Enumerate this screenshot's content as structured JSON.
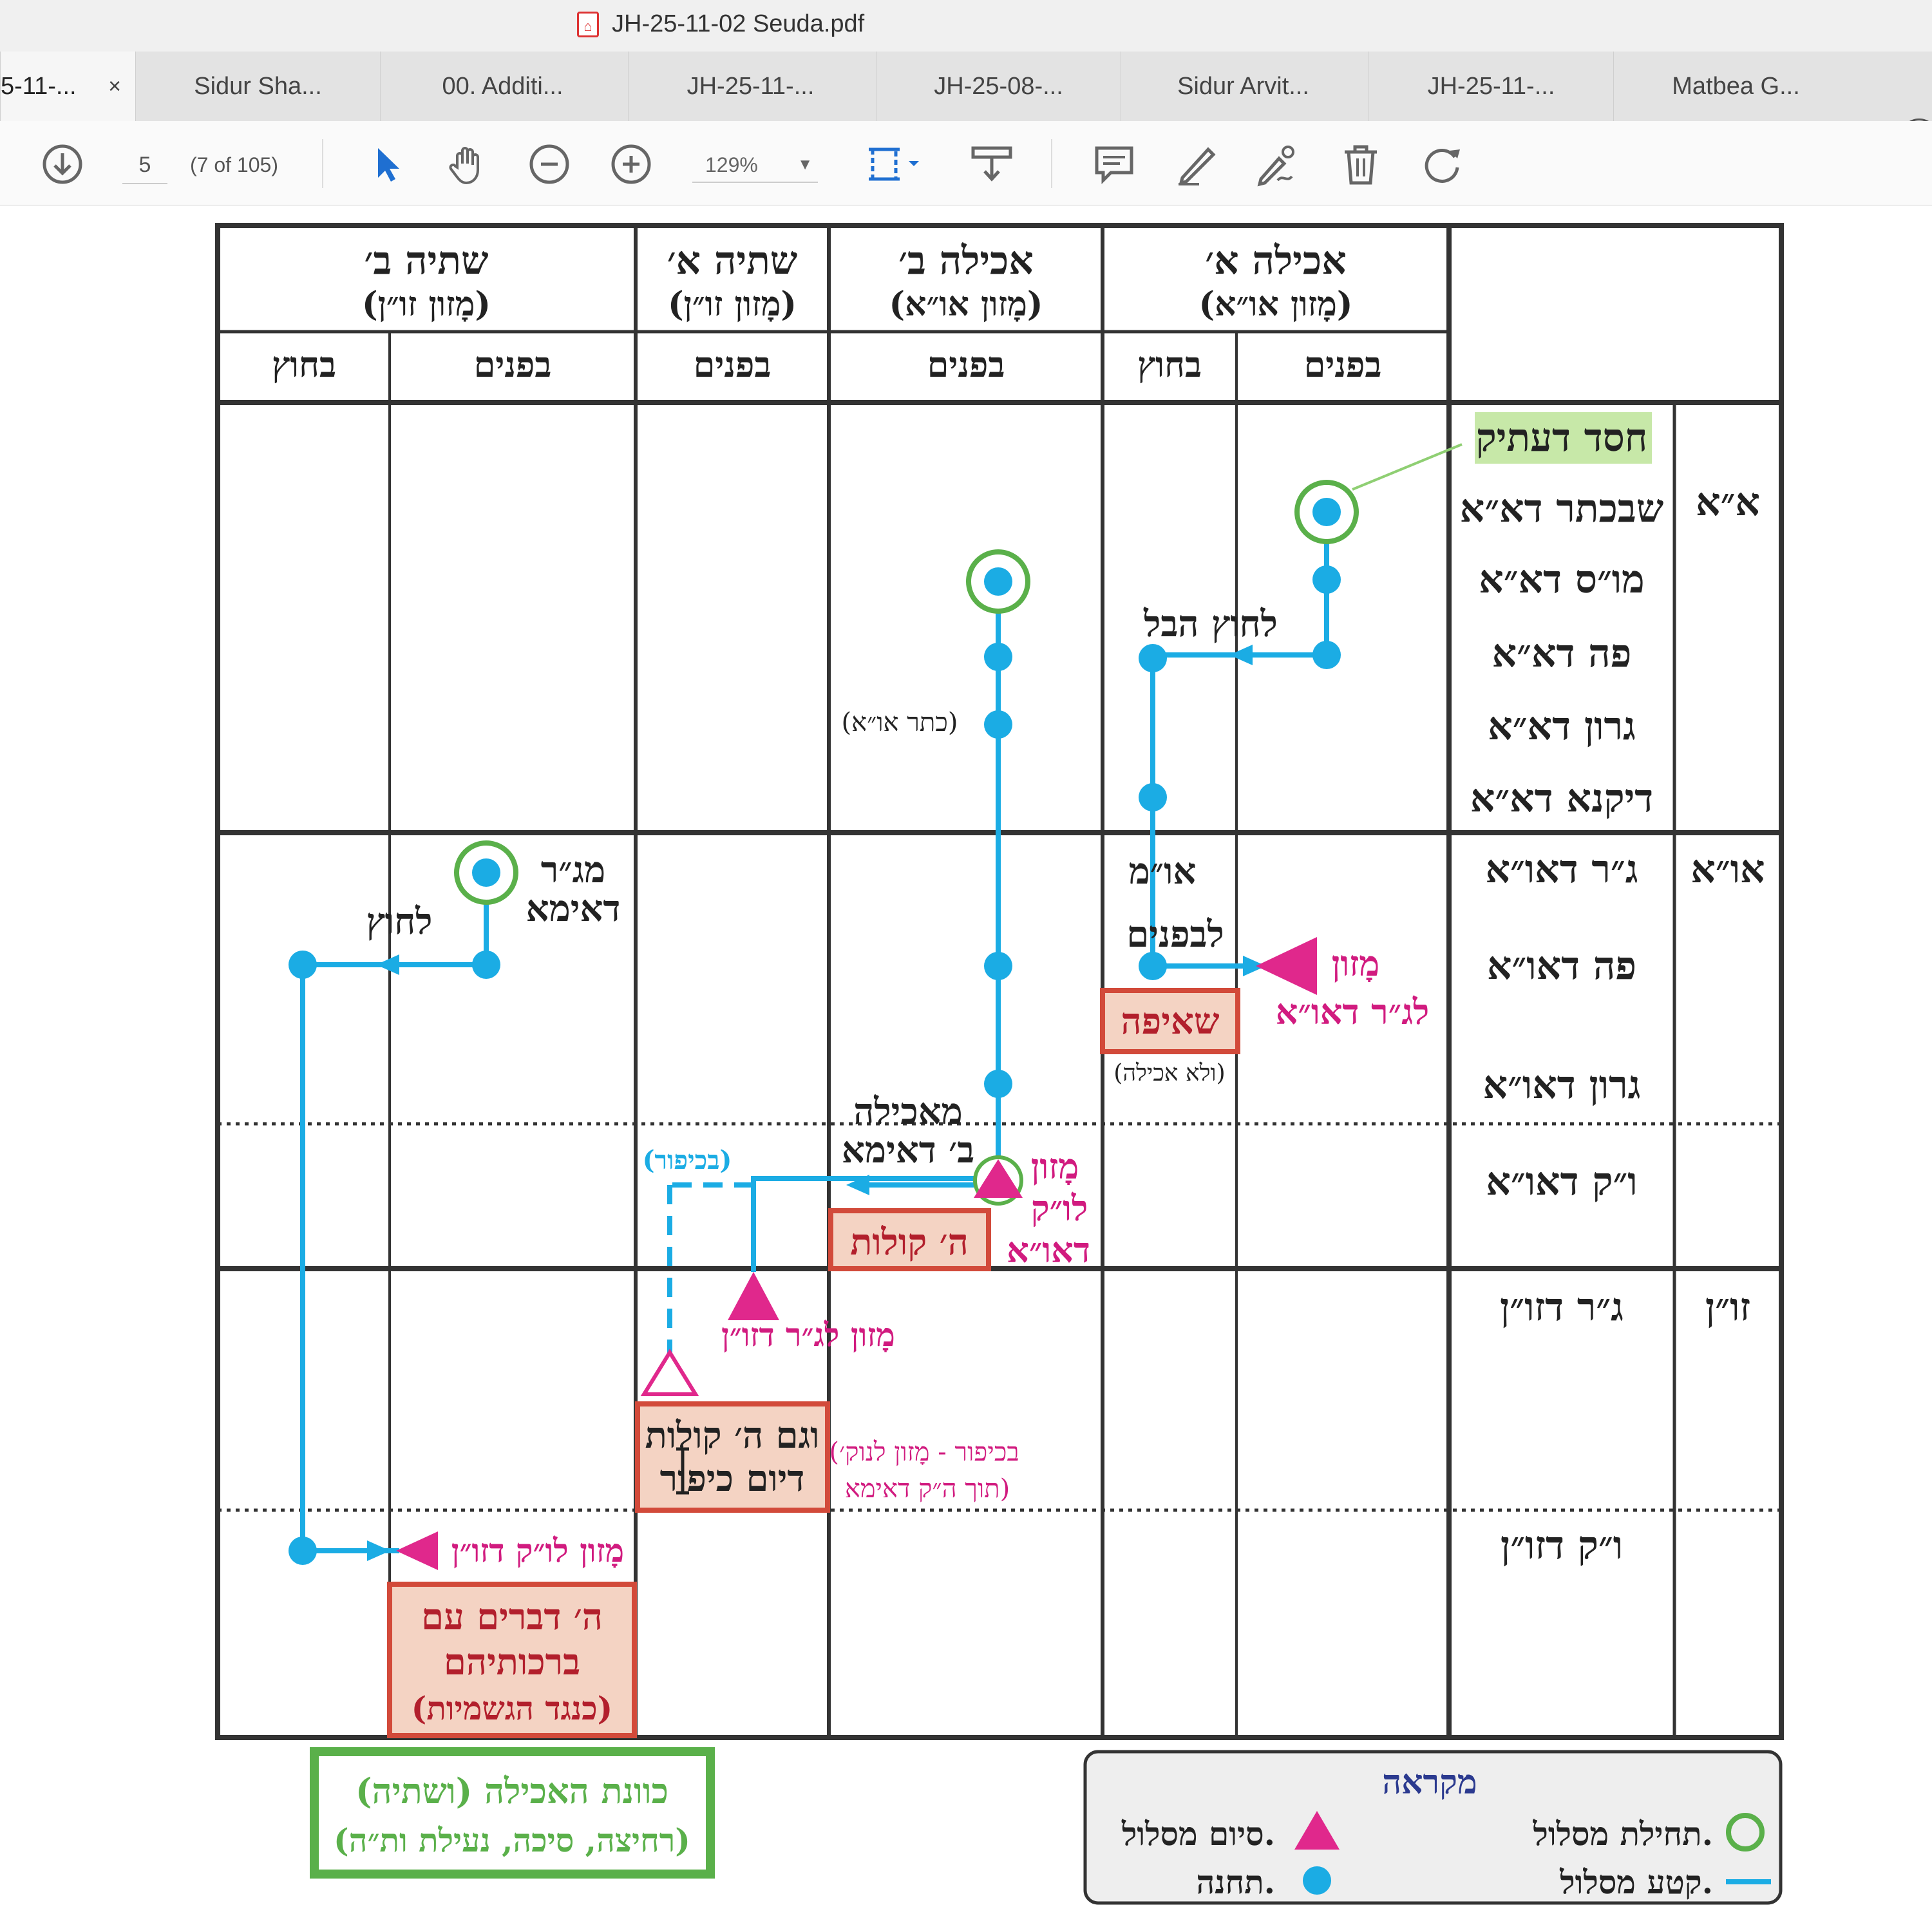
{
  "window": {
    "title": "JH-25-11-02 Seuda.pdf"
  },
  "tabs": [
    {
      "label": "5-11-...",
      "active": true,
      "close": "×"
    },
    {
      "label": "Sidur Sha..."
    },
    {
      "label": "00. Additi..."
    },
    {
      "label": "JH-25-11-..."
    },
    {
      "label": "JH-25-08-..."
    },
    {
      "label": "Sidur Arvit..."
    },
    {
      "label": "JH-25-11-..."
    },
    {
      "label": "Matbea G..."
    }
  ],
  "toolbar": {
    "page_number": "5",
    "page_of": "(7 of 105)",
    "zoom": "129%",
    "help": "?",
    "icons": [
      "download-icon",
      "select-arrow-icon",
      "hand-icon",
      "zoom-out-icon",
      "zoom-in-icon",
      "fit-page-icon",
      "stamp-icon",
      "comment-icon",
      "highlight-pen-icon",
      "sign-icon",
      "delete-icon",
      "rotate-icon"
    ]
  },
  "diagram": {
    "columns": [
      {
        "title": "שתיה ב׳",
        "subtitle": "(מָזון זו״ן)",
        "sub": [
          "בחוץ",
          "בפנים"
        ]
      },
      {
        "title": "שתיה א׳",
        "subtitle": "(מָזון זו״ן)",
        "sub": [
          "בפנים"
        ]
      },
      {
        "title": "אכילה ב׳",
        "subtitle": "(מָזון או״א)",
        "sub": [
          "בפנים"
        ]
      },
      {
        "title": "אכילה א׳",
        "subtitle": "(מָזון או״א)",
        "sub": [
          "בחוץ",
          "בפנים"
        ]
      }
    ],
    "row_groups": [
      {
        "label": "א״א",
        "rows": [
          "חסד דעתיק",
          "שבכתר דא״א",
          "מו״ס דא״א",
          "פה דא״א",
          "גרון דא״א",
          "דיקנא דא״א"
        ]
      },
      {
        "label": "או״א",
        "rows": [
          "ג״ר דאו״א",
          "פה דאו״א",
          "גרון דאו״א",
          "ו״ק דאו״א"
        ]
      },
      {
        "label": "זו״ן",
        "rows": [
          "ג״ר דזו״ן",
          "ו״ק דזו״ן"
        ]
      }
    ],
    "annotations": {
      "lachutz_haKol": "לחוץ הבל",
      "keter_oa": "(כתר או״א)",
      "oam": "או״מ",
      "lifnim": "לבפנים",
      "mazon_lgr_1": "מָזון",
      "mazon_lgr_2": "לג״ר דאו״א",
      "sheifa": "שאיפה",
      "velo_achila": "(ולא אכילה)",
      "megar_1": "מג״ר",
      "megar_2": "דאימא",
      "lachutz": "לחוץ",
      "meachila_1": "מאכילה",
      "meachila_2": "ב׳ דאימא",
      "bkipur": "(בכיפור)",
      "mazon_lvk_1": "מָזון",
      "mazon_lvk_2": "לו״ק",
      "mazon_lvk_3": "דאו״א",
      "hei_kolot": "ה׳ קולות",
      "mazon_lgr_zon": "מָזון לג״ר דזו״ן",
      "vegam_1": "וגם ה׳ קולות",
      "vegam_2": "דיום כיפור",
      "bkipur_note_1": "(בכיפור - מָזון לנוק׳",
      "bkipur_note_2": "תוך ה״ק דאימא)",
      "mazon_lvk_zon": "מָזון לו״ק דזו״ן",
      "hei_dvarim_1": "ה׳ דברים עם",
      "hei_dvarim_2": "ברכותיהם",
      "hei_dvarim_3": "(כנגד הגשמיות)"
    },
    "intent_box": {
      "line1": "כוונת האכילה (ושתיה)",
      "line2": "(רחיצה, סיכה, נעילת ות״ה)"
    },
    "legend": {
      "title": "מקראה",
      "start": "תחילת מסלול.",
      "end": "סיום מסלול.",
      "segment": "קטע מסלול.",
      "station": "תחנה."
    },
    "colors": {
      "path": "#1bace4",
      "start_ring": "#5ab04a",
      "end_triangle": "#e0288c",
      "highlight": "#c7e8a8",
      "box_fill": "#f4d3c3",
      "box_border": "#d24a3a",
      "magenta_text": "#d11b7f"
    }
  }
}
